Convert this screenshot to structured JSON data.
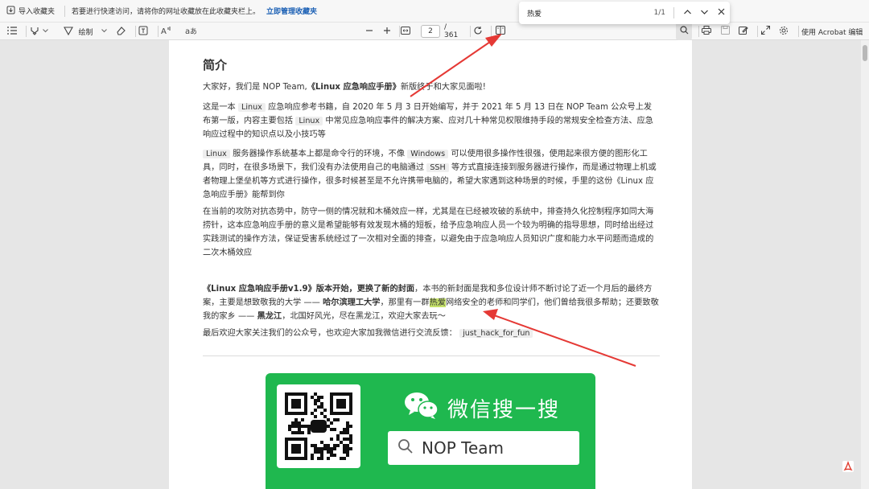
{
  "favorites_bar": {
    "import_label": "导入收藏夹",
    "message": "若要进行快速访问，请将你的网址收藏放在此收藏夹栏上。",
    "manage_link": "立即管理收藏夹"
  },
  "toolbar": {
    "draw_label": "绘制",
    "page_current": "2",
    "page_total": "/ 361",
    "acrobat_label": "使用 Acrobat 编辑"
  },
  "find": {
    "query": "热爱",
    "count": "1/1"
  },
  "document": {
    "title": "简介",
    "p1": {
      "a": "大家好，我们是 NOP Team,",
      "b": "《Linux 应急响应手册》",
      "c": "新版终于和大家见面啦!"
    },
    "p2": {
      "a": "这是一本",
      "code1": "Linux",
      "b": "应急响应参考书籍，自 2020 年 5 月 3 日开始编写，并于 2021 年 5 月 13 日在 NOP Team 公众号上发布第一版，内容主要包括",
      "code2": "Linux",
      "c": "中常见应急响应事件的解决方案、应对几十种常见权限维持手段的常规安全检查方法、应急响应过程中的知识点以及小技巧等"
    },
    "p3": {
      "code1": "Linux",
      "a": "服务器操作系统基本上都是命令行的环境，不像",
      "code2": "Windows",
      "b": "可以使用很多操作性很强，使用起来很方便的图形化工具，同时，在很多场景下，我们没有办法使用自己的电脑通过",
      "code3": "SSH",
      "c": "等方式直接连接到服务器进行操作，而是通过物理上机或者物理上堡垒机等方式进行操作，很多时候甚至是不允许携带电脑的，希望大家遇到这种场景的时候，手里的这份《Linux 应急响应手册》能帮到你"
    },
    "p4": "在当前的攻防对抗态势中，防守一侧的情况就和木桶效应一样，尤其是在已经被攻破的系统中，排查持久化控制程序如同大海捞针，这本应急响应手册的意义是希望能够有效发现木桶的短板，给予应急响应人员一个较为明确的指导思想，同时给出经过实践测试的操作方法，保证受害系统经过了一次相对全面的排查，以避免由于应急响应人员知识广度和能力水平问题而造成的二次木桶效应",
    "p5": {
      "bold1": "《Linux 应急响应手册v1.9》版本开始，更换了新的封面",
      "a": "，本书的新封面是我和多位设计师不断讨论了近一个月后的最终方案，主要是想致敬我的大学 ——",
      "bold2": "哈尔滨理工大学",
      "b": "，那里有一群",
      "highlight": "热爱",
      "c": "网络安全的老师和同学们，他们曾给我很多帮助；还要致敬我的家乡 ——",
      "bold3": "黑龙江",
      "d": "，北国好风光，尽在黑龙江，欢迎大家去玩～"
    },
    "p6": {
      "a": "最后欢迎大家关注我们的公众号，也欢迎大家加我微信进行交流反馈：",
      "code": "just_hack_for_fun"
    },
    "wechat_banner": {
      "title": "微信搜一搜",
      "search_text": "NOP Team",
      "color": "#1fb84f"
    }
  },
  "colors": {
    "highlight": "#c6e26a",
    "annotation": "#e53935",
    "link": "#1a5fb4"
  }
}
